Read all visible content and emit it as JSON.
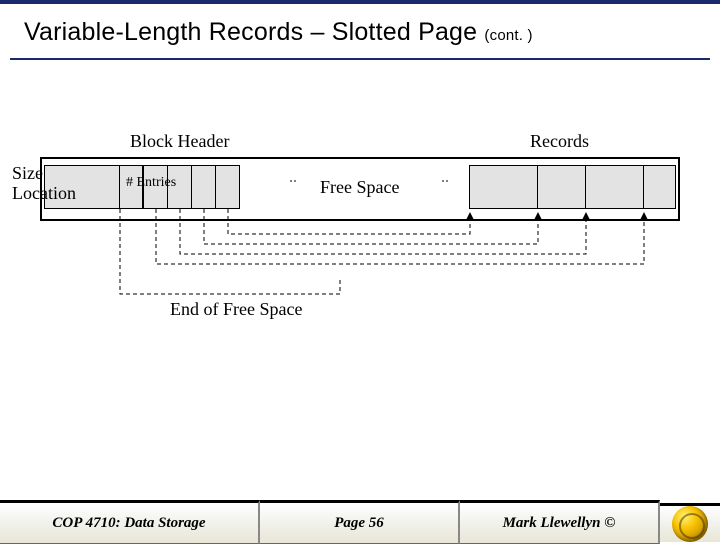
{
  "title": {
    "main": "Variable-Length Records – Slotted Page",
    "cont": "(cont. )"
  },
  "diagram": {
    "block_header": "Block Header",
    "records": "Records",
    "size_location": "Size\nLocation",
    "entries": "# Entries",
    "free_space": "Free Space",
    "end_of_free_space": "End of Free Space"
  },
  "footer": {
    "course": "COP 4710: Data Storage",
    "page": "Page 56",
    "author": "Mark Llewellyn ©"
  }
}
